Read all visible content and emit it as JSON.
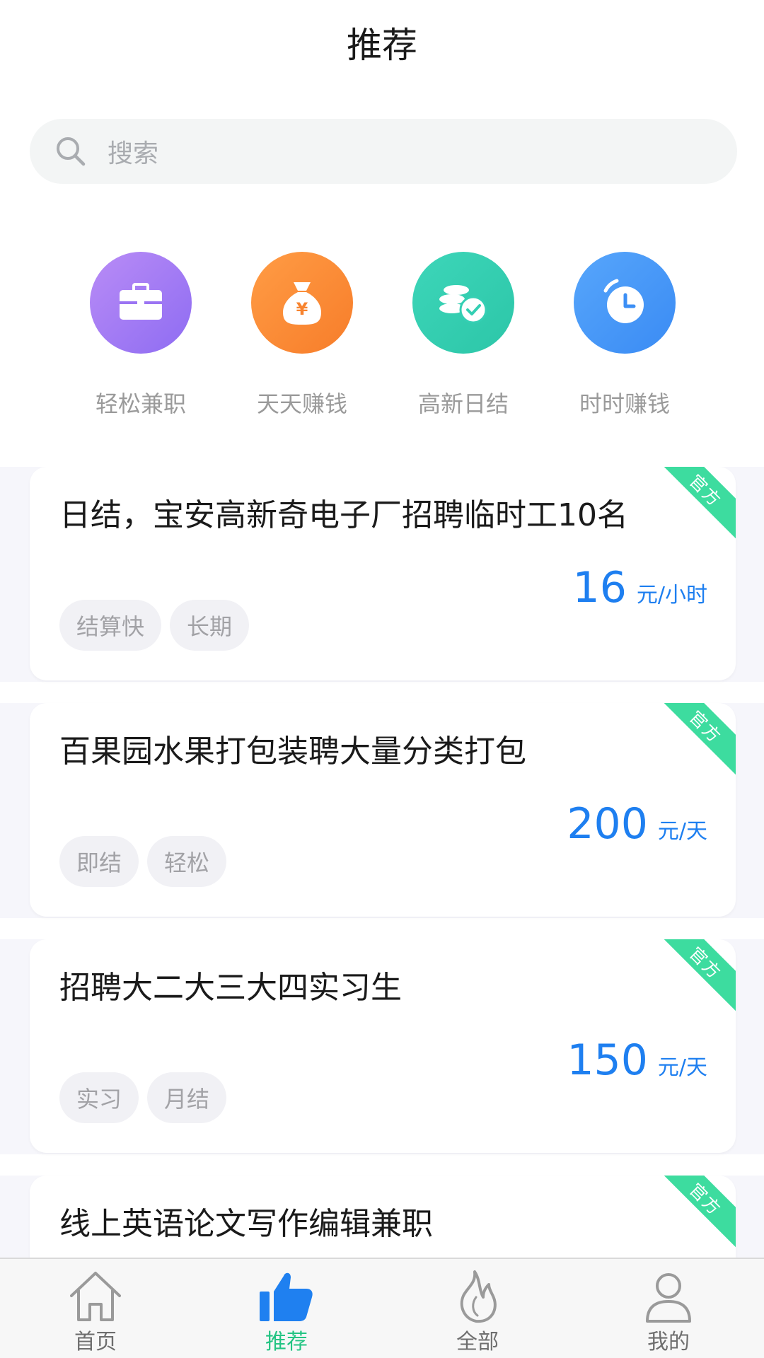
{
  "header": {
    "title": "推荐"
  },
  "search": {
    "placeholder": "搜索"
  },
  "categories": [
    {
      "label": "轻松兼职",
      "icon": "briefcase-icon",
      "color": "#a37cf4"
    },
    {
      "label": "天天赚钱",
      "icon": "money-bag-icon",
      "color": "#fb8a35"
    },
    {
      "label": "高新日结",
      "icon": "coins-icon",
      "color": "#34cfb3"
    },
    {
      "label": "时时赚钱",
      "icon": "clock-icon",
      "color": "#3c8ff5"
    }
  ],
  "jobs": [
    {
      "title": "日结，宝安高新奇电子厂招聘临时工10名",
      "amount": "16",
      "unit": "元/小时",
      "tags": [
        "结算快",
        "长期"
      ],
      "badge": "官方"
    },
    {
      "title": "百果园水果打包装聘大量分类打包",
      "amount": "200",
      "unit": "元/天",
      "tags": [
        "即结",
        "轻松"
      ],
      "badge": "官方"
    },
    {
      "title": "招聘大二大三大四实习生",
      "amount": "150",
      "unit": "元/天",
      "tags": [
        "实习",
        "月结"
      ],
      "badge": "官方"
    },
    {
      "title": "线上英语论文写作编辑兼职",
      "amount": "",
      "unit": "",
      "tags": [],
      "badge": "官方"
    }
  ],
  "tabbar": {
    "items": [
      {
        "label": "首页",
        "icon": "home-icon"
      },
      {
        "label": "推荐",
        "icon": "thumbs-up-icon"
      },
      {
        "label": "全部",
        "icon": "flame-icon"
      },
      {
        "label": "我的",
        "icon": "person-icon"
      }
    ],
    "active_color": "#24c483"
  }
}
